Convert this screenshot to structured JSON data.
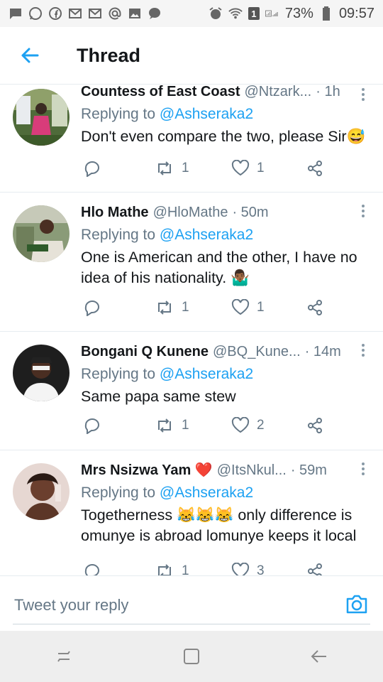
{
  "status_bar": {
    "left_icons": [
      "message-icon",
      "whatsapp-icon",
      "facebook-icon",
      "gmail-icon",
      "gmail-icon",
      "at-icon",
      "image-icon",
      "chat-bubble-icon"
    ],
    "right_icons": [
      "alarm-icon",
      "wifi-icon",
      "sim-icon",
      "signal-icon",
      "battery-icon"
    ],
    "sim_badge": "1",
    "battery": "73%",
    "time": "09:57"
  },
  "header": {
    "title": "Thread",
    "back_icon": "arrow-left-icon",
    "accent": "#1da1f2"
  },
  "tweets": [
    {
      "name": "Countess of East Coast",
      "handle": "@Ntzark...",
      "time": "· 1h",
      "replying_prefix": "Replying to ",
      "replying_user": "@Ashseraka2",
      "text": "Don't even compare the two, please Sir😅",
      "retweets": "1",
      "likes": "1"
    },
    {
      "name": "Hlo Mathe",
      "handle": "@HloMathe",
      "time": "· 50m",
      "replying_prefix": "Replying to ",
      "replying_user": "@Ashseraka2",
      "text": "One is American and the other, I have no idea of his nationality. 🤷🏾‍♂️",
      "retweets": "1",
      "likes": "1"
    },
    {
      "name": "Bongani Q Kunene",
      "handle": "@BQ_Kune...",
      "time": "· 14m",
      "replying_prefix": "Replying to ",
      "replying_user": "@Ashseraka2",
      "text": "Same papa same stew",
      "retweets": "1",
      "likes": "2"
    },
    {
      "name": "Mrs Nsizwa Yam ❤️",
      "handle": "@ItsNkul...",
      "time": "· 59m",
      "replying_prefix": "Replying to ",
      "replying_user": "@Ashseraka2",
      "text": "Togetherness 😹😹😹 only difference is omunye is abroad lomunye keeps it local",
      "retweets": "1",
      "likes": "3"
    }
  ],
  "composer": {
    "placeholder": "Tweet your reply",
    "camera_icon": "camera-icon"
  },
  "nav_bar": {
    "icons": [
      "recents-icon",
      "home-icon",
      "back-icon"
    ]
  }
}
